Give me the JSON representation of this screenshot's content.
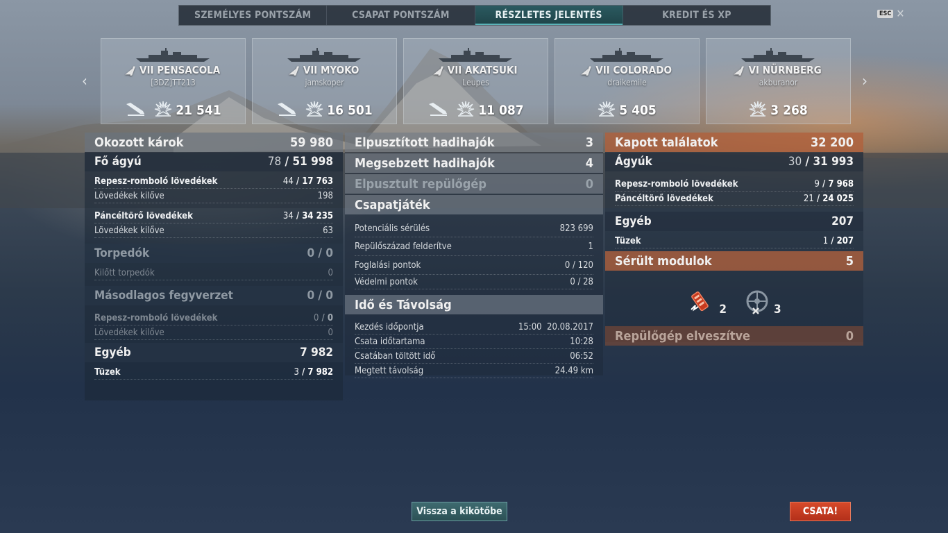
{
  "tabs": [
    "SZEMÉLYES PONTSZÁM",
    "CSAPAT PONTSZÁM",
    "RÉSZLETES JELENTÉS",
    "KREDIT ÉS XP"
  ],
  "active_tab": "RÉSZLETES JELENTÉS",
  "esc": {
    "key": "ESC",
    "close": "✕"
  },
  "ships": [
    {
      "tier": "VII",
      "name": "PENSACOLA",
      "player": "[3DZ]TT213",
      "damage": "21 541",
      "icons": [
        "torpedo-hit-icon",
        "explosion-icon"
      ]
    },
    {
      "tier": "VII",
      "name": "MYOKO",
      "player": "jamskoper",
      "damage": "16 501",
      "icons": [
        "torpedo-hit-icon",
        "explosion-icon"
      ]
    },
    {
      "tier": "VII",
      "name": "AKATSUKI",
      "player": "Leupes",
      "damage": "11 087",
      "icons": [
        "torpedo-hit-icon",
        "explosion-icon"
      ]
    },
    {
      "tier": "VII",
      "name": "COLORADO",
      "player": "draikemile",
      "damage": "5 405",
      "icons": [
        "explosion-icon"
      ]
    },
    {
      "tier": "VI",
      "name": "NÜRNBERG",
      "player": "akburanor",
      "damage": "3 268",
      "icons": [
        "explosion-icon"
      ]
    }
  ],
  "left": {
    "damage_title": "Okozott károk",
    "damage_total": "59 980",
    "main_guns": {
      "label": "Fő ágyú",
      "hits": "78",
      "value": "51 998"
    },
    "he": {
      "label": "Repesz-romboló lövedékek",
      "hits": "44",
      "value": "17 763"
    },
    "he_fired": {
      "label": "Lövedékek kilőve",
      "value": "198"
    },
    "ap": {
      "label": "Páncéltörő lövedékek",
      "hits": "34",
      "value": "34 235"
    },
    "ap_fired": {
      "label": "Lövedékek kilőve",
      "value": "63"
    },
    "torpedoes": {
      "label": "Torpedók",
      "hits": "0",
      "value": "0"
    },
    "torp_fired": {
      "label": "Kilőtt torpedók",
      "value": "0"
    },
    "secondary": {
      "label": "Másodlagos fegyverzet",
      "hits": "0",
      "value": "0"
    },
    "sec_he": {
      "label": "Repesz-romboló lövedékek",
      "hits": "0",
      "value": "0"
    },
    "sec_fired": {
      "label": "Lövedékek kilőve",
      "value": "0"
    },
    "other": {
      "label": "Egyéb",
      "value": "7 982"
    },
    "fires": {
      "label": "Tüzek",
      "hits": "3",
      "value": "7 982"
    }
  },
  "middle": {
    "destroyed": {
      "label": "Elpusztított hadihajók",
      "value": "3"
    },
    "damaged": {
      "label": "Megsebzett hadihajók",
      "value": "4"
    },
    "planes": {
      "label": "Elpusztult repülőgép",
      "value": "0"
    },
    "team_title": "Csapatjáték",
    "potential": {
      "label": "Potenciális sérülés",
      "value": "823 699"
    },
    "spotted": {
      "label": "Repülőszázad felderítve",
      "value": "1"
    },
    "capture": {
      "label": "Foglalási pontok",
      "value": "0 / 120"
    },
    "defense": {
      "label": "Védelmi pontok",
      "value": "0 / 28"
    },
    "time_title": "Idő és Távolság",
    "start": {
      "label": "Kezdés időpontja",
      "value": "15:00  20.08.2017"
    },
    "duration": {
      "label": "Csata időtartama",
      "value": "10:28"
    },
    "alive": {
      "label": "Csatában töltött idő",
      "value": "06:52"
    },
    "distance": {
      "label": "Megtett távolság",
      "value": "24.49 km"
    }
  },
  "right": {
    "received_title": "Kapott találatok",
    "received_total": "32 200",
    "guns": {
      "label": "Ágyúk",
      "hits": "30",
      "value": "31 993"
    },
    "he": {
      "label": "Repesz-romboló lövedékek",
      "hits": "9",
      "value": "7 968"
    },
    "ap": {
      "label": "Páncéltörő lövedékek",
      "hits": "21",
      "value": "24 025"
    },
    "other": {
      "label": "Egyéb",
      "value": "207"
    },
    "fires": {
      "label": "Tüzek",
      "hits": "1",
      "value": "207"
    },
    "modules_title": "Sérült modulok",
    "modules_total": "5",
    "module_a": {
      "icon": "engine-module-icon",
      "count": "2"
    },
    "module_b": {
      "icon": "steering-gear-module-icon",
      "count": "3"
    },
    "planes_lost": {
      "label": "Repülőgép elveszítve",
      "value": "0"
    }
  },
  "buttons": {
    "back": "Vissza a kikötőbe",
    "battle": "CSATA!"
  },
  "colors": {
    "accent_teal": "#2b5a60",
    "received_orange": "#d66e3c",
    "battle_red": "#d74a2a"
  }
}
